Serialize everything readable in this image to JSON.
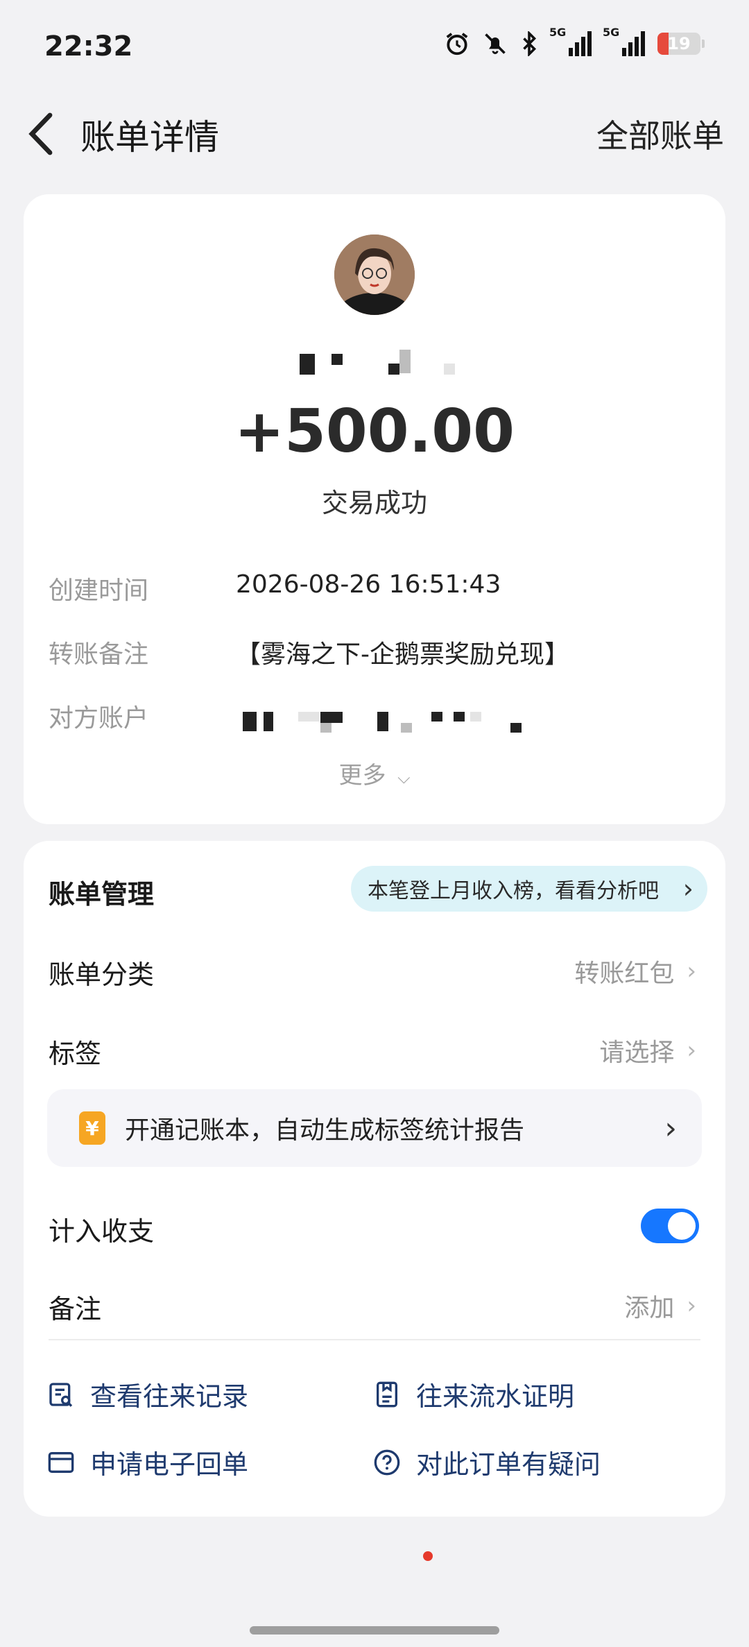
{
  "status_bar": {
    "time": "22:32",
    "signal_1_label": "5G",
    "signal_2_label": "5G",
    "battery_level": "19",
    "battery_fraction": 0.19,
    "icons": [
      "alarm-icon",
      "bell-off-icon",
      "bluetooth-icon",
      "signal-icon",
      "signal-icon",
      "battery-icon"
    ]
  },
  "header": {
    "title": "账单详情",
    "right_link": "全部账单",
    "back_icon": "chevron-left-icon"
  },
  "summary": {
    "amount": "+500.00",
    "status": "交易成功",
    "rows": [
      {
        "label": "创建时间",
        "value": "2026-08-26 16:51:43"
      },
      {
        "label": "转账备注",
        "value": "【雾海之下-企鹅票奖励兑现】"
      },
      {
        "label": "对方账户",
        "value": ""
      }
    ],
    "more": "更多"
  },
  "management": {
    "title": "账单管理",
    "pill_text": "本笔登上月收入榜，看看分析吧",
    "items": [
      {
        "label": "账单分类",
        "value": "转账红包"
      },
      {
        "label": "标签",
        "value": "请选择"
      }
    ],
    "promo_icon": "¥",
    "promo_text": "开通记账本，自动生成标签统计报告",
    "include_label": "计入收支",
    "include_enabled": true,
    "note_label": "备注",
    "note_value": "添加",
    "actions": [
      {
        "label": "查看往来记录",
        "icon": "record-search-icon"
      },
      {
        "label": "往来流水证明",
        "icon": "document-icon"
      },
      {
        "label": "申请电子回单",
        "icon": "envelope-icon"
      },
      {
        "label": "对此订单有疑问",
        "icon": "question-circle-icon"
      }
    ]
  },
  "colors": {
    "accent": "#1677ff",
    "pill_bg": "#dcf3f8",
    "action_text": "#1e3a6e",
    "badge_orange": "#f6a623"
  }
}
